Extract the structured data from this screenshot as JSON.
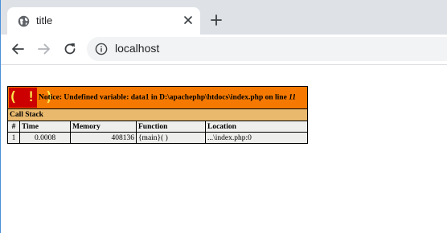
{
  "browser": {
    "tab": {
      "title": "title"
    },
    "address": {
      "url": "localhost"
    }
  },
  "xdebug": {
    "notice": {
      "icon_text": "( ! )",
      "prefix": "Notice: Undefined variable: data1 in D:\\apachephp\\htdocs\\index.php on line ",
      "line": "11"
    },
    "call_stack_label": "Call Stack",
    "columns": [
      "#",
      "Time",
      "Memory",
      "Function",
      "Location"
    ],
    "rows": [
      {
        "num": "1",
        "time": "0.0008",
        "memory": "408136",
        "function": "{main}( )",
        "location": "...\\index.php:0"
      }
    ],
    "colors": {
      "error_bg": "#f57900",
      "callstack_bg": "#e9b96e",
      "cell_bg": "#eeeeec",
      "icon_bg": "#cc0000",
      "icon_fg": "#fce94f"
    }
  }
}
